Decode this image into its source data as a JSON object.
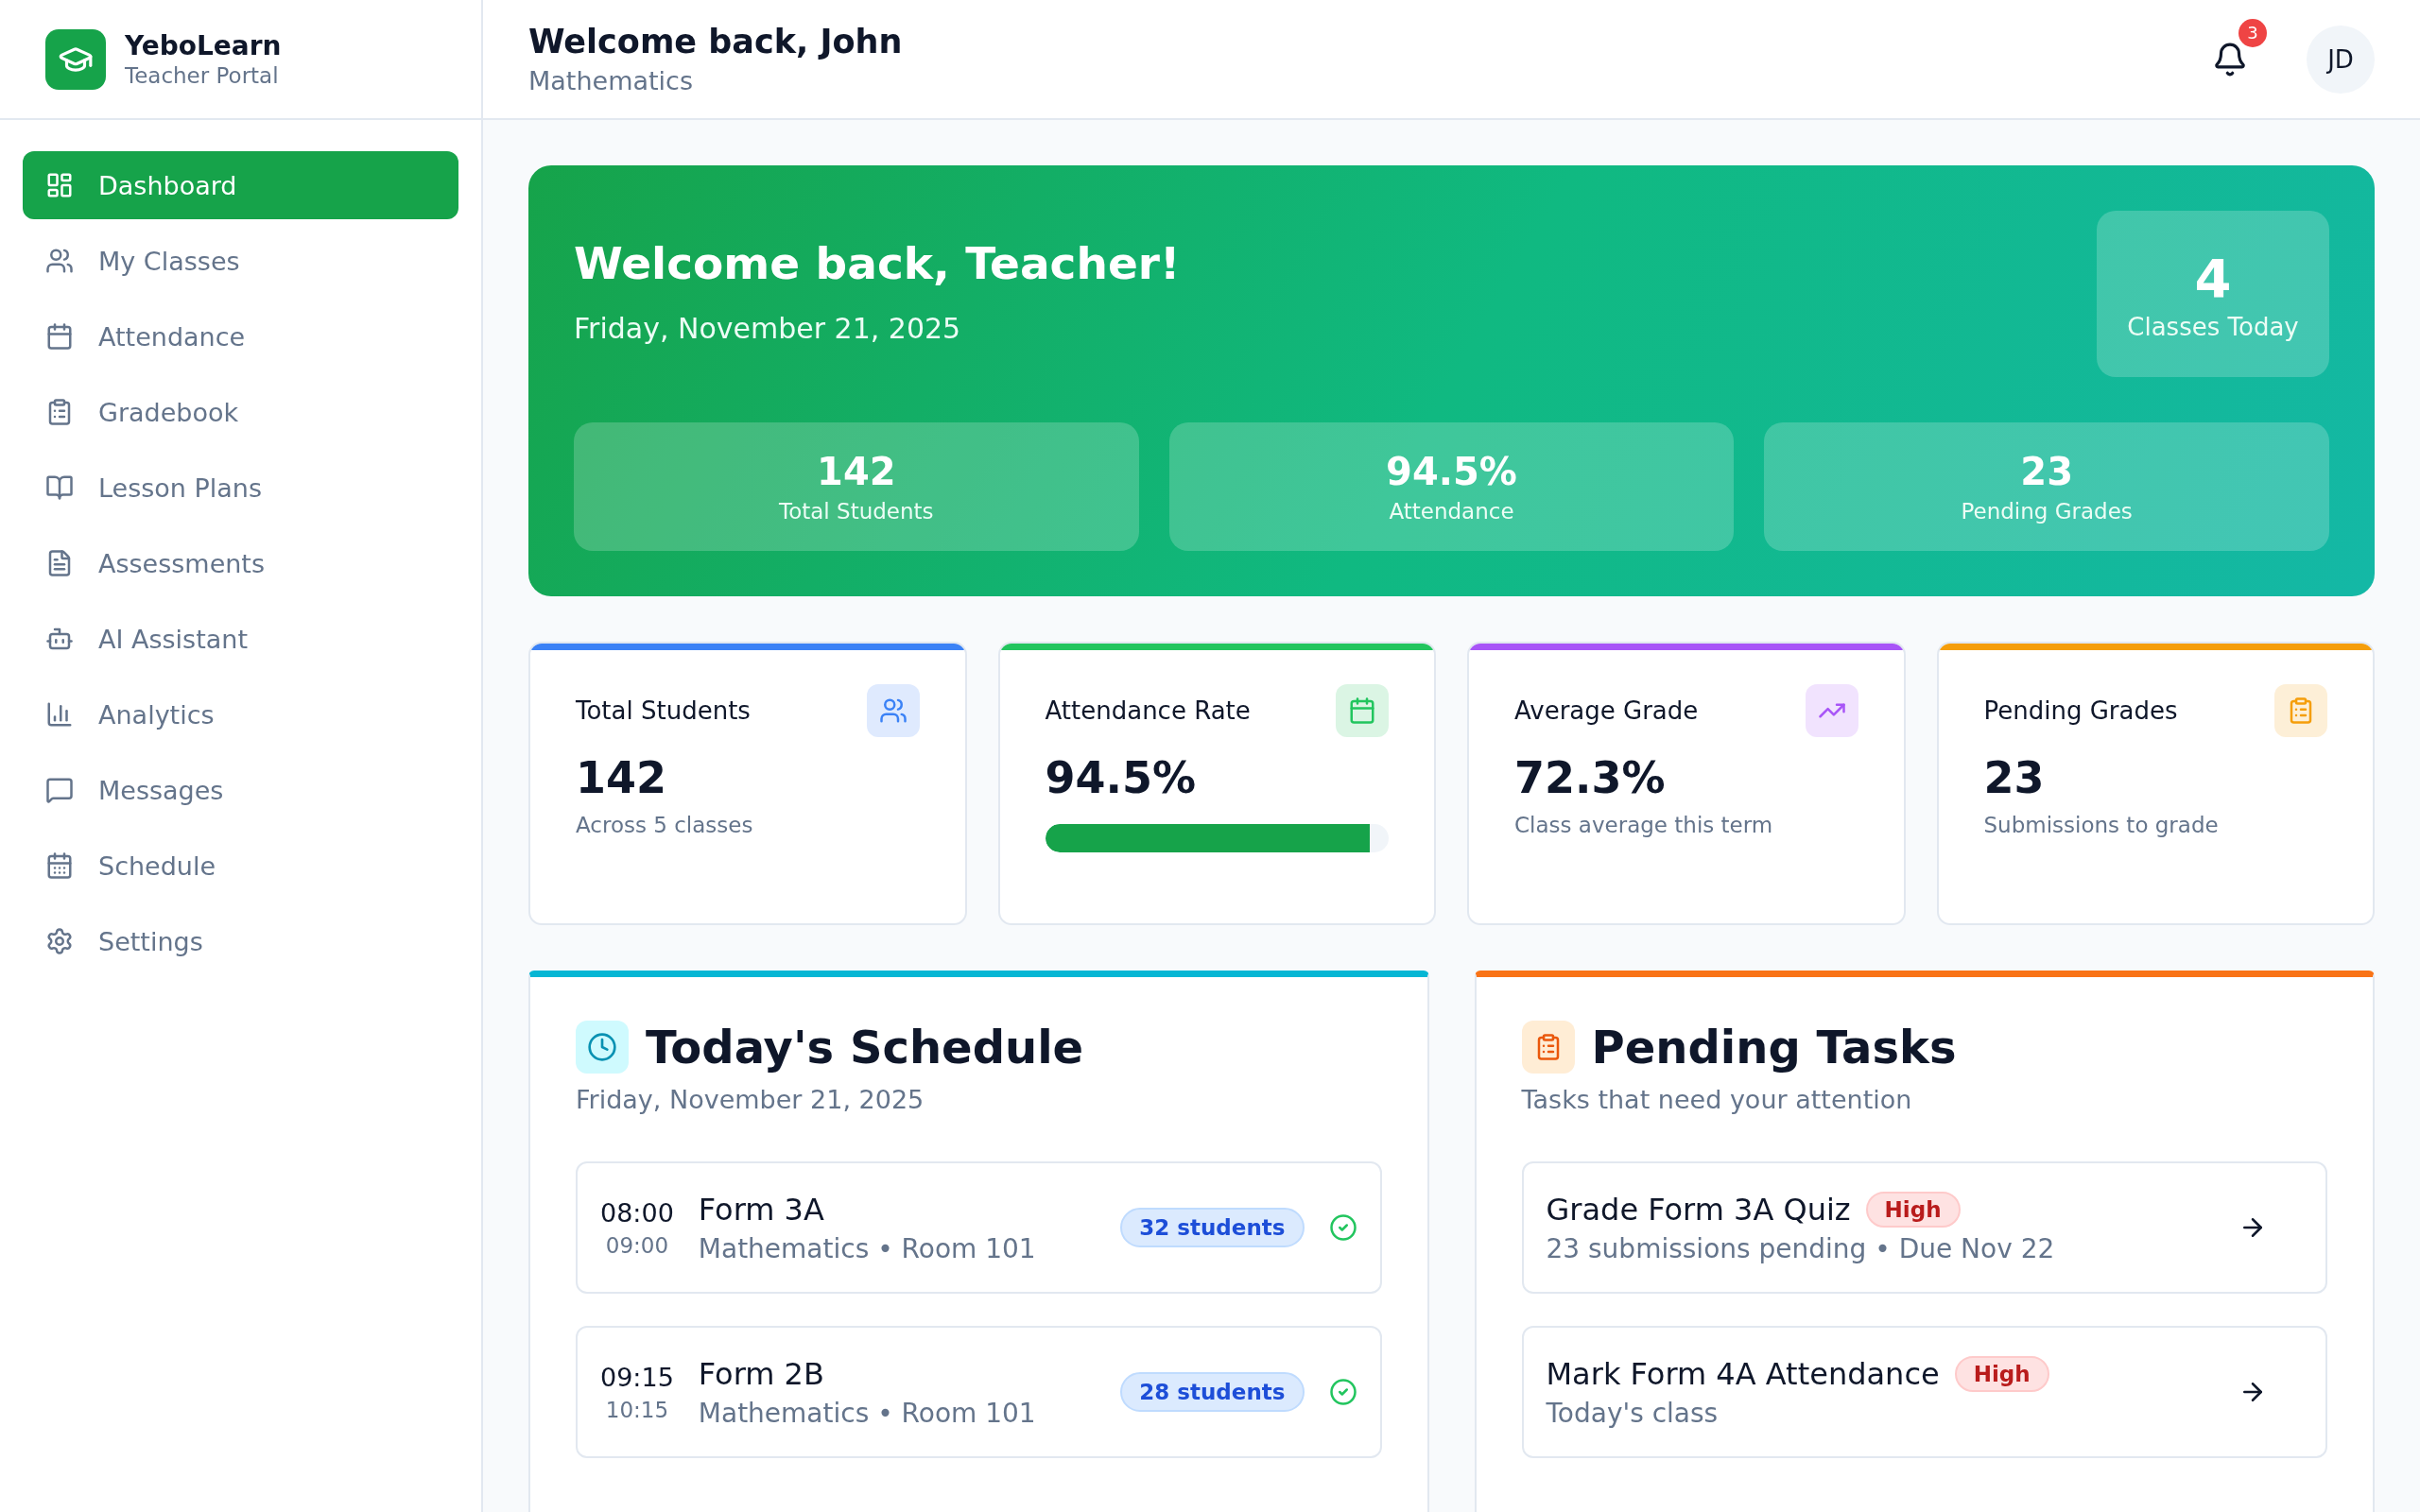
{
  "brand": {
    "name": "YeboLearn",
    "subtitle": "Teacher Portal"
  },
  "sidebar": {
    "items": [
      {
        "label": "Dashboard",
        "selected": true
      },
      {
        "label": "My Classes",
        "selected": false
      },
      {
        "label": "Attendance",
        "selected": false
      },
      {
        "label": "Gradebook",
        "selected": false
      },
      {
        "label": "Lesson Plans",
        "selected": false
      },
      {
        "label": "Assessments",
        "selected": false
      },
      {
        "label": "AI Assistant",
        "selected": false
      },
      {
        "label": "Analytics",
        "selected": false
      },
      {
        "label": "Messages",
        "selected": false
      },
      {
        "label": "Schedule",
        "selected": false
      },
      {
        "label": "Settings",
        "selected": false
      }
    ]
  },
  "header": {
    "title": "Welcome back, John",
    "subtitle": "Mathematics",
    "notifications": "3",
    "avatar": "JD"
  },
  "hero": {
    "title": "Welcome back, Teacher!",
    "date": "Friday, November 21, 2025",
    "classes_today": {
      "value": "4",
      "label": "Classes Today"
    },
    "stats": [
      {
        "value": "142",
        "label": "Total Students"
      },
      {
        "value": "94.5%",
        "label": "Attendance"
      },
      {
        "value": "23",
        "label": "Pending Grades"
      }
    ]
  },
  "stat_cards": [
    {
      "kind": "text",
      "title": "Total Students",
      "value": "142",
      "caption": "Across 5 classes",
      "color": "#3b82f6"
    },
    {
      "kind": "progress",
      "title": "Attendance Rate",
      "value": "94.5%",
      "level": 0.945,
      "color": "#22c55e"
    },
    {
      "kind": "text",
      "title": "Average Grade",
      "value": "72.3%",
      "caption": "Class average this term",
      "color": "#a855f7"
    },
    {
      "kind": "text",
      "title": "Pending Grades",
      "value": "23",
      "caption": "Submissions to grade",
      "color": "#f59e0b"
    }
  ],
  "schedule": {
    "title": "Today's Schedule",
    "date": "Friday, November 21, 2025",
    "items": [
      {
        "start": "08:00",
        "end": "09:00",
        "class": "Form 3A",
        "details": "Mathematics • Room 101",
        "students": "32 students",
        "done": true
      },
      {
        "start": "09:15",
        "end": "10:15",
        "class": "Form 2B",
        "details": "Mathematics • Room 101",
        "students": "28 students",
        "done": true
      }
    ]
  },
  "tasks": {
    "title": "Pending Tasks",
    "subtitle": "Tasks that need your attention",
    "items": [
      {
        "title": "Grade Form 3A Quiz",
        "priority": "High",
        "details": "23 submissions pending • Due Nov 22"
      },
      {
        "title": "Mark Form 4A Attendance",
        "priority": "High",
        "details": "Today's class"
      }
    ]
  }
}
